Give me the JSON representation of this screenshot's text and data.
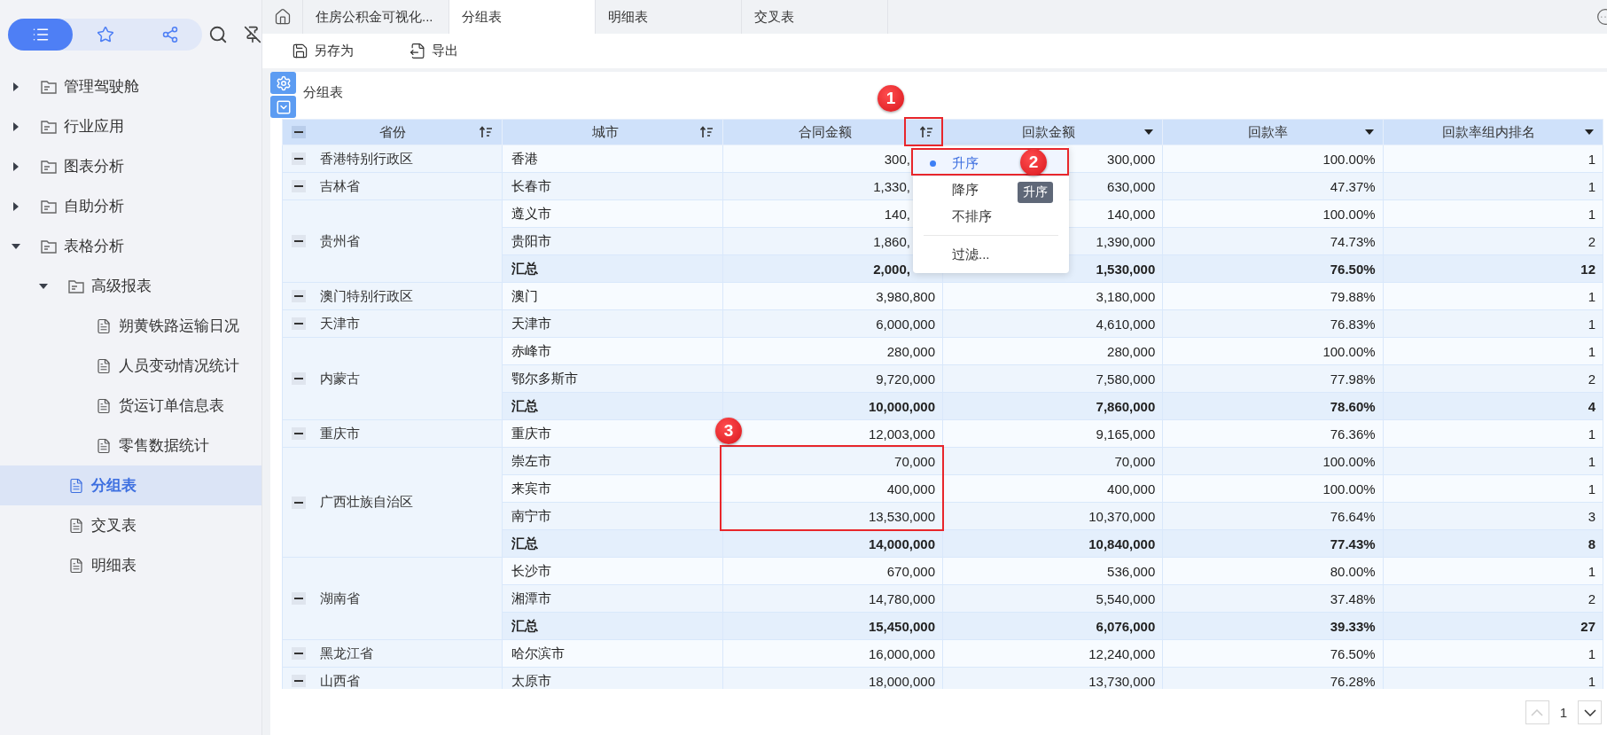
{
  "sidebar": {
    "view_tabs": [
      {
        "selected": true
      },
      {
        "selected": false
      },
      {
        "selected": false
      }
    ],
    "tree": [
      {
        "label": "管理驾驶舱",
        "kind": "folder",
        "expanded": false,
        "selected": false
      },
      {
        "label": "行业应用",
        "kind": "folder",
        "expanded": false,
        "selected": false
      },
      {
        "label": "图表分析",
        "kind": "folder",
        "expanded": false,
        "selected": false
      },
      {
        "label": "自助分析",
        "kind": "folder",
        "expanded": false,
        "selected": false
      },
      {
        "label": "表格分析",
        "kind": "folder",
        "expanded": true,
        "selected": false,
        "children": [
          {
            "label": "高级报表",
            "kind": "folder",
            "expanded": true,
            "selected": false,
            "children": [
              {
                "label": "朔黄铁路运输日况",
                "kind": "file",
                "selected": false
              },
              {
                "label": "人员变动情况统计",
                "kind": "file",
                "selected": false
              },
              {
                "label": "货运订单信息表",
                "kind": "file",
                "selected": false
              },
              {
                "label": "零售数据统计",
                "kind": "file",
                "selected": false
              }
            ]
          },
          {
            "label": "分组表",
            "kind": "file",
            "selected": true
          },
          {
            "label": "交叉表",
            "kind": "file",
            "selected": false
          },
          {
            "label": "明细表",
            "kind": "file",
            "selected": false
          }
        ]
      }
    ]
  },
  "tabs": [
    {
      "label": "住房公积金可视化...",
      "selected": false
    },
    {
      "label": "分组表",
      "selected": true
    },
    {
      "label": "明细表",
      "selected": false
    },
    {
      "label": "交叉表",
      "selected": false
    }
  ],
  "toolbar": [
    "另存为",
    "导出"
  ],
  "report": {
    "title": "分组表",
    "columns": [
      {
        "label": "省份",
        "kind": "sort"
      },
      {
        "label": "城市",
        "kind": "sort"
      },
      {
        "label": "合同金额",
        "kind": "sort"
      },
      {
        "label": "回款金额",
        "kind": "dropdown"
      },
      {
        "label": "回款率",
        "kind": "dropdown"
      },
      {
        "label": "回款率组内排名",
        "kind": "dropdown"
      }
    ],
    "groups": [
      {
        "province": "香港特别行政区",
        "rows": [
          {
            "kind": "data",
            "covered": true,
            "cells": [
              "香港",
              "300,",
              "300,000",
              "100.00%",
              "1"
            ]
          }
        ]
      },
      {
        "province": "吉林省",
        "rows": [
          {
            "kind": "data",
            "covered": true,
            "cells": [
              "长春市",
              "1,330,",
              "630,000",
              "47.37%",
              "1"
            ]
          }
        ]
      },
      {
        "province": "贵州省",
        "rows": [
          {
            "kind": "data",
            "covered": true,
            "cells": [
              "遵义市",
              "140,",
              "140,000",
              "100.00%",
              "1"
            ]
          },
          {
            "kind": "data",
            "covered": true,
            "cells": [
              "贵阳市",
              "1,860,",
              "1,390,000",
              "74.73%",
              "2"
            ]
          },
          {
            "kind": "total",
            "covered": true,
            "cells": [
              "汇总",
              "2,000,",
              "1,530,000",
              "76.50%",
              "12"
            ]
          }
        ]
      },
      {
        "province": "澳门特别行政区",
        "rows": [
          {
            "kind": "data",
            "covered": false,
            "cells": [
              "澳门",
              "3,980,800",
              "3,180,000",
              "79.88%",
              "1"
            ]
          }
        ]
      },
      {
        "province": "天津市",
        "rows": [
          {
            "kind": "data",
            "covered": false,
            "cells": [
              "天津市",
              "6,000,000",
              "4,610,000",
              "76.83%",
              "1"
            ]
          }
        ]
      },
      {
        "province": "内蒙古",
        "rows": [
          {
            "kind": "data",
            "covered": false,
            "cells": [
              "赤峰市",
              "280,000",
              "280,000",
              "100.00%",
              "1"
            ]
          },
          {
            "kind": "data",
            "covered": false,
            "cells": [
              "鄂尔多斯市",
              "9,720,000",
              "7,580,000",
              "77.98%",
              "2"
            ]
          },
          {
            "kind": "total",
            "covered": false,
            "cells": [
              "汇总",
              "10,000,000",
              "7,860,000",
              "78.60%",
              "4"
            ]
          }
        ]
      },
      {
        "province": "重庆市",
        "rows": [
          {
            "kind": "data",
            "covered": false,
            "cells": [
              "重庆市",
              "12,003,000",
              "9,165,000",
              "76.36%",
              "1"
            ]
          }
        ]
      },
      {
        "province": "广西壮族自治区",
        "rows": [
          {
            "kind": "data",
            "covered": false,
            "cells": [
              "崇左市",
              "70,000",
              "70,000",
              "100.00%",
              "1"
            ]
          },
          {
            "kind": "data",
            "covered": false,
            "cells": [
              "来宾市",
              "400,000",
              "400,000",
              "100.00%",
              "1"
            ]
          },
          {
            "kind": "data",
            "covered": false,
            "cells": [
              "南宁市",
              "13,530,000",
              "10,370,000",
              "76.64%",
              "3"
            ]
          },
          {
            "kind": "total",
            "covered": false,
            "cells": [
              "汇总",
              "14,000,000",
              "10,840,000",
              "77.43%",
              "8"
            ]
          }
        ]
      },
      {
        "province": "湖南省",
        "rows": [
          {
            "kind": "data",
            "covered": false,
            "cells": [
              "长沙市",
              "670,000",
              "536,000",
              "80.00%",
              "1"
            ]
          },
          {
            "kind": "data",
            "covered": false,
            "cells": [
              "湘潭市",
              "14,780,000",
              "5,540,000",
              "37.48%",
              "2"
            ]
          },
          {
            "kind": "total",
            "covered": false,
            "cells": [
              "汇总",
              "15,450,000",
              "6,076,000",
              "39.33%",
              "27"
            ]
          }
        ]
      },
      {
        "province": "黑龙江省",
        "rows": [
          {
            "kind": "data",
            "covered": false,
            "cells": [
              "哈尔滨市",
              "16,000,000",
              "12,240,000",
              "76.50%",
              "1"
            ]
          }
        ]
      },
      {
        "province": "山西省",
        "rows": [
          {
            "kind": "data",
            "covered": false,
            "cells": [
              "太原市",
              "18,000,000",
              "13,730,000",
              "76.28%",
              "1"
            ]
          }
        ]
      }
    ],
    "sort_menu": {
      "options": [
        {
          "label": "升序",
          "selected": true
        },
        {
          "label": "降序",
          "selected": false
        },
        {
          "label": "不排序",
          "selected": false
        }
      ],
      "filter": "过滤...",
      "tooltip": "升序"
    },
    "annotations": [
      {
        "label": "1"
      },
      {
        "label": "2"
      },
      {
        "label": "3"
      }
    ]
  },
  "pager": {
    "page": "1",
    "prev_disabled": true,
    "next_disabled": false
  }
}
